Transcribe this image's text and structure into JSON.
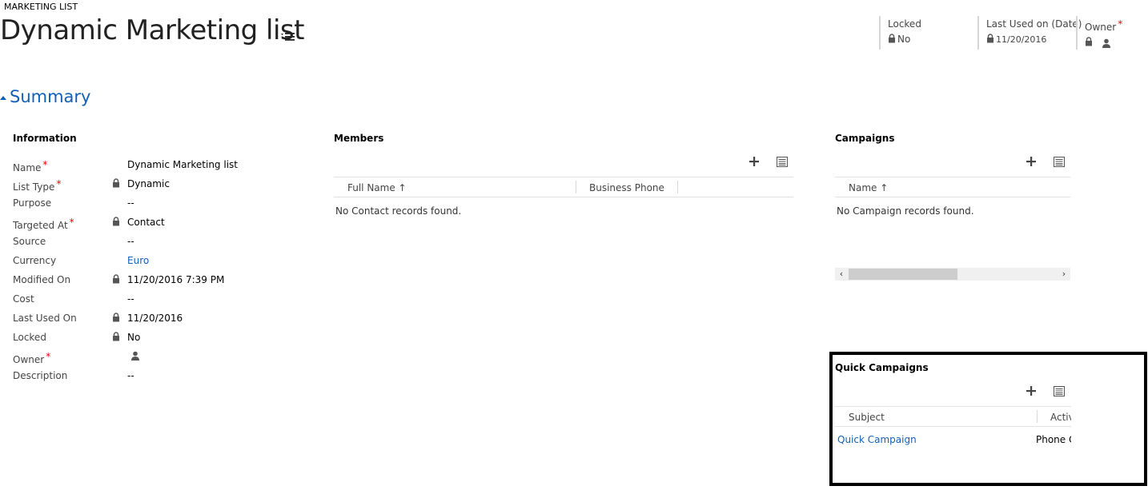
{
  "header": {
    "entity_type": "MARKETING LIST",
    "record_title": "Dynamic Marketing list",
    "fields": [
      {
        "label": "Locked",
        "value": "No",
        "required": false
      },
      {
        "label": "Last Used on (Date)",
        "value": "11/20/2016",
        "required": false
      },
      {
        "label": "Owner",
        "value": "",
        "required": true
      }
    ]
  },
  "summary": {
    "title": "Summary",
    "information": {
      "heading": "Information",
      "fields": [
        {
          "label": "Name",
          "value": "Dynamic Marketing list",
          "required": true,
          "locked": false,
          "link": false
        },
        {
          "label": "List Type",
          "value": "Dynamic",
          "required": true,
          "locked": true,
          "link": false
        },
        {
          "label": "Purpose",
          "value": "--",
          "required": false,
          "locked": false,
          "link": false
        },
        {
          "label": "Targeted At",
          "value": "Contact",
          "required": true,
          "locked": true,
          "link": false
        },
        {
          "label": "Source",
          "value": "--",
          "required": false,
          "locked": false,
          "link": false
        },
        {
          "label": "Currency",
          "value": "Euro",
          "required": false,
          "locked": false,
          "link": true
        },
        {
          "label": "Modified On",
          "value": "11/20/2016   7:39 PM",
          "required": false,
          "locked": true,
          "link": false
        },
        {
          "label": "Cost",
          "value": "--",
          "required": false,
          "locked": false,
          "link": false
        },
        {
          "label": "Last Used On",
          "value": "11/20/2016",
          "required": false,
          "locked": true,
          "link": false
        },
        {
          "label": "Locked",
          "value": "No",
          "required": false,
          "locked": true,
          "link": false
        },
        {
          "label": "Owner",
          "value": "",
          "required": true,
          "locked": false,
          "link": false
        },
        {
          "label": "Description",
          "value": "--",
          "required": false,
          "locked": false,
          "link": false
        }
      ]
    },
    "members": {
      "heading": "Members",
      "columns": [
        "Full Name ↑",
        "Business Phone"
      ],
      "empty_message": "No Contact records found."
    },
    "campaigns": {
      "heading": "Campaigns",
      "columns": [
        "Name ↑"
      ],
      "empty_message": "No Campaign records found."
    },
    "quick_campaigns": {
      "heading": "Quick Campaigns",
      "columns": [
        "Subject",
        "Activi"
      ],
      "rows": [
        {
          "subject": "Quick Campaign",
          "activity": "Phone C"
        }
      ]
    }
  },
  "colors": {
    "link": "#1160b7",
    "required": "#e00000"
  }
}
